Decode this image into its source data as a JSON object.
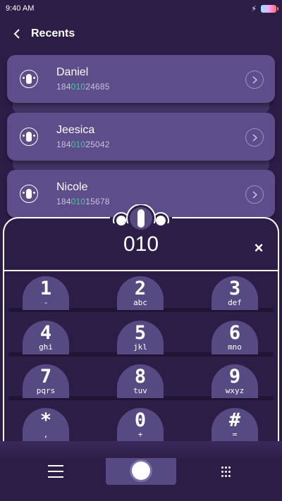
{
  "status_bar": {
    "time": "9:40 AM"
  },
  "header": {
    "title": "Recents"
  },
  "recents": [
    {
      "name": "Daniel",
      "number_prefix": "184",
      "number_match": "010",
      "number_suffix": "24685"
    },
    {
      "name": "Jeesica",
      "number_prefix": "184",
      "number_match": "010",
      "number_suffix": "25042"
    },
    {
      "name": "Nicole",
      "number_prefix": "184",
      "number_match": "010",
      "number_suffix": "15678"
    }
  ],
  "dialer": {
    "number": "010",
    "clear_label": "×",
    "keys": [
      {
        "digit": "1",
        "letters": "-"
      },
      {
        "digit": "2",
        "letters": "abc"
      },
      {
        "digit": "3",
        "letters": "def"
      },
      {
        "digit": "4",
        "letters": "ghi"
      },
      {
        "digit": "5",
        "letters": "jkl"
      },
      {
        "digit": "6",
        "letters": "mno"
      },
      {
        "digit": "7",
        "letters": "pqrs"
      },
      {
        "digit": "8",
        "letters": "tuv"
      },
      {
        "digit": "9",
        "letters": "wxyz"
      },
      {
        "digit": "*",
        "letters": ","
      },
      {
        "digit": "0",
        "letters": "+"
      },
      {
        "digit": "#",
        "letters": "="
      }
    ]
  },
  "icons": {
    "back": "chevron-left-icon",
    "avatar": "contact-avatar-icon",
    "chevron": "chevron-right-icon",
    "menu": "menu-icon",
    "call": "call-icon",
    "keypad": "keypad-icon"
  },
  "colors": {
    "background": "#2c1d47",
    "card": "#5d4d8a",
    "key": "#574a82",
    "match_highlight": "#3ed09a"
  }
}
